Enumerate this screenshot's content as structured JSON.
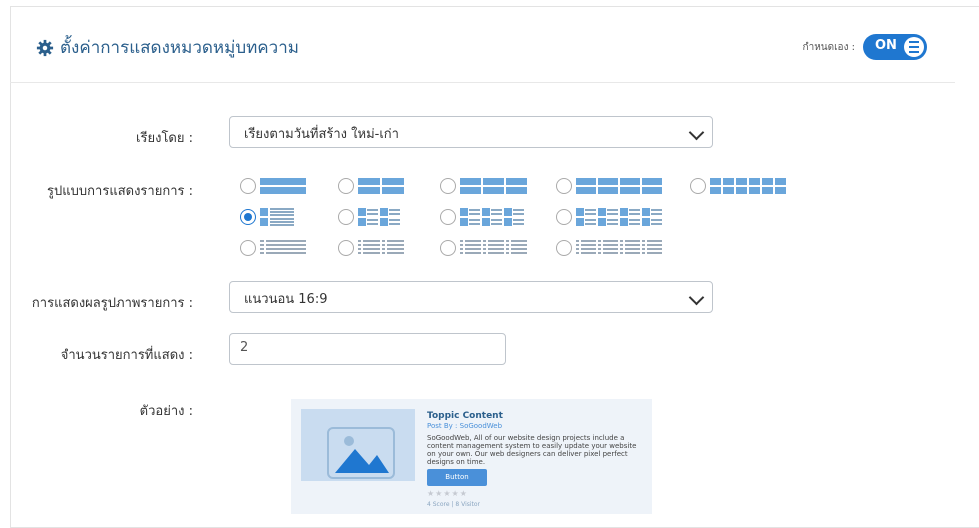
{
  "header": {
    "title": "ตั้งค่าการแสดงหมวดหมู่บทความ",
    "custom_label": "กำหนดเอง :",
    "toggle_label": "ON"
  },
  "form": {
    "sort_label": "เรียงโดย :",
    "sort_value": "เรียงตามวันที่สร้าง ใหม่-เก่า",
    "layout_label": "รูปแบบการแสดงรายการ :",
    "image_label": "การแสดงผลรูปภาพรายการ :",
    "image_value": "แนวนอน 16:9",
    "count_label": "จำนวนรายการที่แสดง :",
    "count_value": "2",
    "preview_label": "ตัวอย่าง :"
  },
  "layouts": {
    "selected": "list-image-left",
    "options": [
      "grid-1",
      "grid-2",
      "grid-3",
      "grid-4",
      "grid-6",
      "list-image-left",
      "list-image-2",
      "list-image-3",
      "list-image-4",
      "list-text-1",
      "list-text-2",
      "list-text-3",
      "list-text-4"
    ]
  },
  "preview": {
    "title": "Toppic Content",
    "post_by": "Post By : SoGoodWeb",
    "description": "SoGoodWeb, All of our website design projects include a content management system to easily update your website on your own. Our web designers can deliver pixel perfect designs on time.",
    "button_label": "Button",
    "stars": "★★★★★",
    "score": "4 Score | 8 Visitor"
  },
  "colors": {
    "accent": "#1f77d0",
    "title": "#2b5f8c",
    "layout_block": "#6aa6db"
  }
}
